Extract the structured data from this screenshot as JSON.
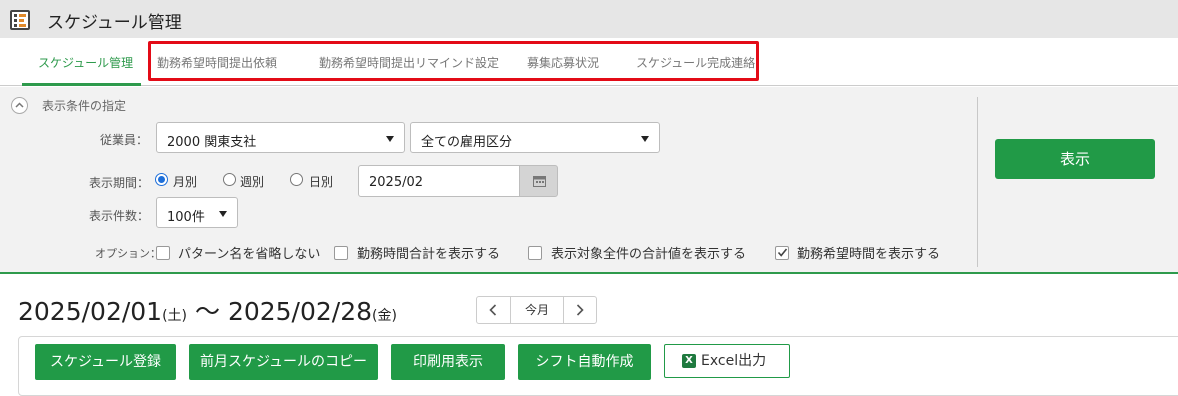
{
  "app": {
    "title": "スケジュール管理"
  },
  "tabs": [
    {
      "label": "スケジュール管理",
      "active": true
    },
    {
      "label": "勤務希望時間提出依頼",
      "active": false
    },
    {
      "label": "勤務希望時間提出リマインド設定",
      "active": false
    },
    {
      "label": "募集応募状況",
      "active": false
    },
    {
      "label": "スケジュール完成連絡",
      "active": false
    }
  ],
  "filter": {
    "section_title": "表示条件の指定",
    "employee_label": "従業員：",
    "employee_value": "2000 関東支社",
    "employment_type_value": "全ての雇用区分",
    "period_label": "表示期間：",
    "period_options": [
      "月別",
      "週別",
      "日別"
    ],
    "period_selected": "月別",
    "date_value": "2025/02",
    "count_label": "表示件数：",
    "count_value": "100件",
    "options_label": "オプション：",
    "options": [
      {
        "label": "パターン名を省略しない",
        "checked": false
      },
      {
        "label": "勤務時間合計を表示する",
        "checked": false
      },
      {
        "label": "表示対象全件の合計値を表示する",
        "checked": false
      },
      {
        "label": "勤務希望時間を表示する",
        "checked": true
      }
    ],
    "show_button": "表示"
  },
  "period": {
    "start": "2025/02/01",
    "start_weekday": "(土)",
    "separator": " 〜 ",
    "end": "2025/02/28",
    "end_weekday": "(金)"
  },
  "nav": {
    "today": "今月"
  },
  "actions": {
    "register": "スケジュール登録",
    "copy_prev": "前月スケジュールのコピー",
    "print": "印刷用表示",
    "auto_shift": "シフト自動作成",
    "excel": "Excel出力"
  },
  "colors": {
    "accent": "#219a47",
    "highlight_border": "#e30b17"
  },
  "icons": [
    "app-icon",
    "collapse-icon",
    "calendar-icon",
    "chevron-left-icon",
    "chevron-right-icon",
    "checkmark-icon",
    "excel-icon"
  ]
}
